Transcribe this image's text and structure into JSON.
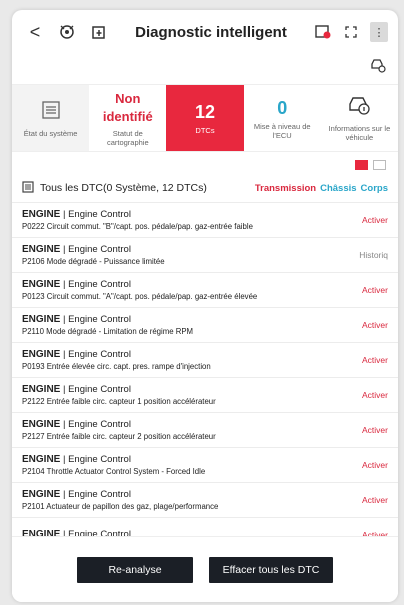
{
  "header": {
    "back_glyph": "<",
    "title": "Diagnostic intelligent"
  },
  "summary": [
    {
      "value": "",
      "label": "État du système"
    },
    {
      "value": "Non identifié",
      "label": "Statut de cartographie"
    },
    {
      "value": "12",
      "label": "DTCs"
    },
    {
      "value": "0",
      "label": "Mise à niveau de l'ECU"
    },
    {
      "value": "",
      "label": "Informations sur le véhicule"
    }
  ],
  "filter": {
    "all_label": "Tous les DTC(0 Système, 12 DTCs)",
    "transmission": "Transmission",
    "chassis": "Châssis",
    "corps": "Corps"
  },
  "dtcs": [
    {
      "system": "ENGINE",
      "module": "Engine Control",
      "code": "P0222",
      "desc": "Circuit commut. \"B\"/capt. pos. pédale/pap. gaz-entrée faible",
      "status": "Activer"
    },
    {
      "system": "ENGINE",
      "module": "Engine Control",
      "code": "P2106",
      "desc": "Mode dégradé - Puissance limitée",
      "status": "Historiq"
    },
    {
      "system": "ENGINE",
      "module": "Engine Control",
      "code": "P0123",
      "desc": "Circuit commut. \"A\"/capt. pos. pédale/pap. gaz-entrée élevée",
      "status": "Activer"
    },
    {
      "system": "ENGINE",
      "module": "Engine Control",
      "code": "P2110",
      "desc": "Mode dégradé - Limitation de régime RPM",
      "status": "Activer"
    },
    {
      "system": "ENGINE",
      "module": "Engine Control",
      "code": "P0193",
      "desc": "Entrée élevée circ. capt. pres. rampe d'injection",
      "status": "Activer"
    },
    {
      "system": "ENGINE",
      "module": "Engine Control",
      "code": "P2122",
      "desc": "Entrée faible circ. capteur 1 position accélérateur",
      "status": "Activer"
    },
    {
      "system": "ENGINE",
      "module": "Engine Control",
      "code": "P2127",
      "desc": "Entrée faible circ. capteur 2 position accélérateur",
      "status": "Activer"
    },
    {
      "system": "ENGINE",
      "module": "Engine Control",
      "code": "P2104",
      "desc": "Throttle Actuator Control System - Forced Idle",
      "status": "Activer"
    },
    {
      "system": "ENGINE",
      "module": "Engine Control",
      "code": "P2101",
      "desc": "Actuateur de papillon des gaz, plage/performance",
      "status": "Activer"
    },
    {
      "system": "ENGINE",
      "module": "Engine Control",
      "code": "",
      "desc": "",
      "status": "Activer"
    }
  ],
  "buttons": {
    "reanalyse": "Re-analyse",
    "clear": "Effacer tous les DTC"
  },
  "colors": {
    "accent_red": "#e8283e",
    "accent_blue": "#2aa6c9",
    "button_dark": "#1b1f26"
  }
}
